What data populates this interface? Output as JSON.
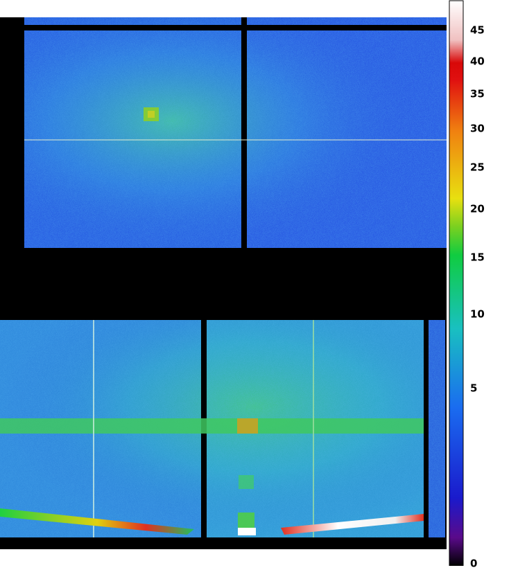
{
  "colorbar": {
    "tick_labels": [
      {
        "label": "45",
        "value": 45
      },
      {
        "label": "40",
        "value": 40
      },
      {
        "label": "35",
        "value": 35
      },
      {
        "label": "30",
        "value": 30
      },
      {
        "label": "25",
        "value": 25
      },
      {
        "label": "20",
        "value": 20
      },
      {
        "label": "15",
        "value": 15
      },
      {
        "label": "10",
        "value": 10
      },
      {
        "label": "5",
        "value": 5
      },
      {
        "label": "0",
        "value": 0
      }
    ],
    "stops": [
      "#000000",
      "#5a0a8a",
      "#1a1acc",
      "#1a6cf0",
      "#19c0c0",
      "#10cc40",
      "#7ad020",
      "#e8e010",
      "#f08010",
      "#e01010",
      "#d80808",
      "#f0c0c0",
      "#ffffff"
    ]
  },
  "image": {
    "background": "#000000",
    "base_low": "#1a3ad8",
    "base_mid": "#2aa0d8",
    "base_high": "#20c8a0",
    "hot": "#e03020",
    "streak": "#ffffff"
  }
}
